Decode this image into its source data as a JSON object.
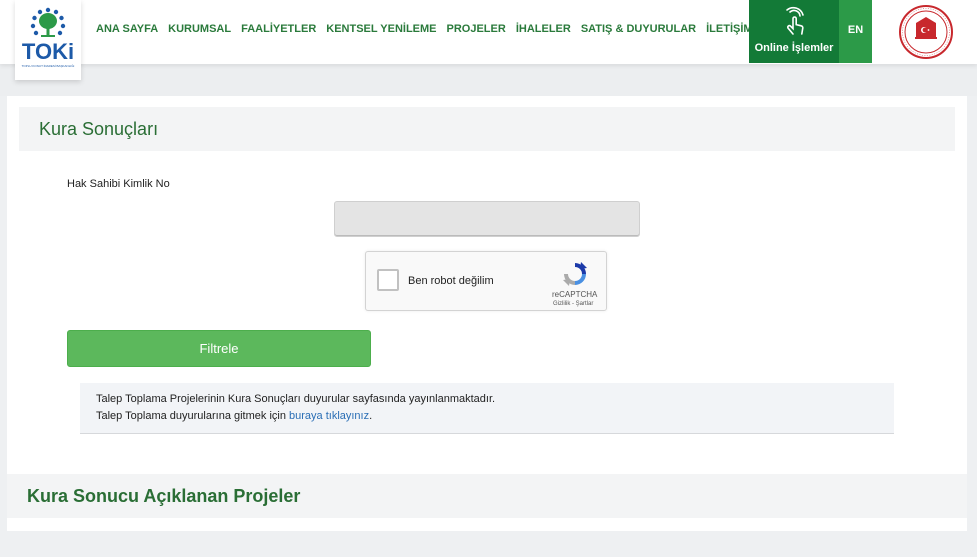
{
  "header": {
    "logo_text": "TOKi",
    "logo_subtitle": "TOPLU KONUT İDARESİ BAŞKANLIĞI",
    "nav": [
      {
        "label": "ANA SAYFA"
      },
      {
        "label": "KURUMSAL"
      },
      {
        "label": "FAALİYETLER"
      },
      {
        "label": "KENTSEL YENİLEME"
      },
      {
        "label": "PROJELER"
      },
      {
        "label": "İHALELER"
      },
      {
        "label": "SATIŞ & DUYURULAR"
      },
      {
        "label": "İLETİŞİM"
      }
    ],
    "online_label": "Online İşlemler",
    "lang_label": "EN",
    "brand_color": "#137a37",
    "accent_color": "#2c9a48"
  },
  "main": {
    "title": "Kura Sonuçları",
    "field_label": "Hak Sahibi Kimlik No",
    "kimlik_value": "",
    "recaptcha": {
      "label": "Ben robot değilim",
      "brand": "reCAPTCHA",
      "links": "Gizlilik - Şartlar"
    },
    "filter_label": "Filtrele",
    "info": {
      "line1": "Talep Toplama Projelerinin Kura Sonuçları duyurular sayfasında yayınlanmaktadır.",
      "line2_prefix": "Talep Toplama duyurularına gitmek için ",
      "line2_link": "buraya tıklayınız",
      "line2_suffix": "."
    },
    "section2_title": "Kura Sonucu Açıklanan Projeler"
  }
}
